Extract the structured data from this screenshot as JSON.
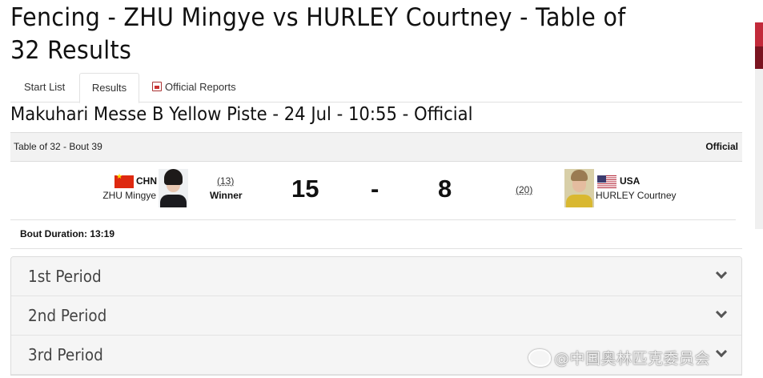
{
  "page": {
    "title": "Fencing - ZHU Mingye vs HURLEY Courtney - Table of 32 Results",
    "subtitle": "Makuhari Messe B Yellow Piste - 24 Jul - 10:55 - Official"
  },
  "tabs": [
    {
      "label": "Start List",
      "active": false
    },
    {
      "label": "Results",
      "active": true
    },
    {
      "label": "Official Reports",
      "active": false,
      "icon": "pdf-icon"
    }
  ],
  "bout": {
    "label": "Table of 32 - Bout 39",
    "status": "Official",
    "duration_label": "Bout Duration:",
    "duration_value": "13:19"
  },
  "athletes": {
    "left": {
      "noc": "CHN",
      "name": "ZHU Mingye",
      "seed": "(13)",
      "result": "Winner",
      "score": "15",
      "flag": "china-flag-icon"
    },
    "right": {
      "noc": "USA",
      "name": "HURLEY Courtney",
      "seed": "(20)",
      "score": "8",
      "flag": "usa-flag-icon"
    }
  },
  "score_separator": "-",
  "periods": [
    {
      "label": "1st Period"
    },
    {
      "label": "2nd Period"
    },
    {
      "label": "3rd Period"
    }
  ],
  "watermark": "@中国奥林匹克委员会",
  "colors": {
    "accent": "#c22a3a",
    "period_bg": "#f5f5f5"
  }
}
